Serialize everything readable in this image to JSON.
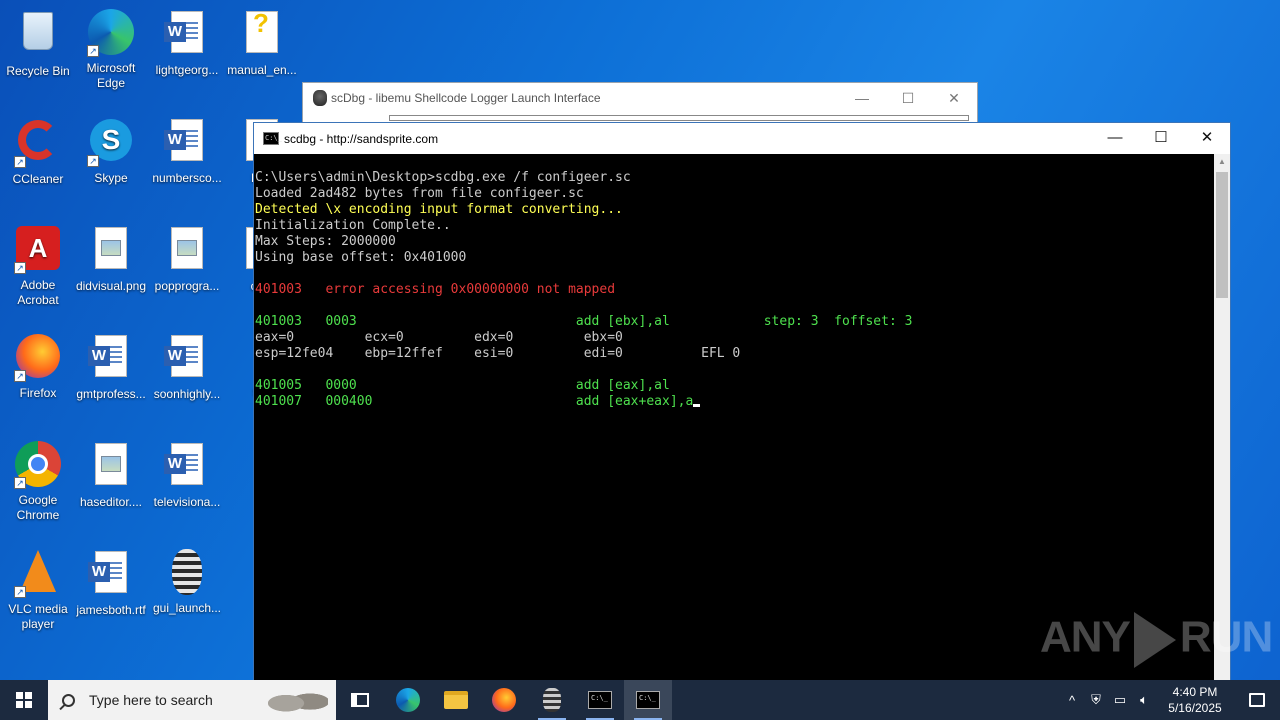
{
  "desktop": {
    "icons": [
      {
        "label": "Recycle Bin",
        "icon": "recycle-bin-icon"
      },
      {
        "label": "Microsoft Edge",
        "icon": "edge-icon"
      },
      {
        "label": "lightgeorg...",
        "icon": "word-doc-icon"
      },
      {
        "label": "manual_en...",
        "icon": "help-doc-icon"
      },
      {
        "label": "CCleaner",
        "icon": "ccleaner-icon"
      },
      {
        "label": "Skype",
        "icon": "skype-icon"
      },
      {
        "label": "numbersco...",
        "icon": "word-doc-icon"
      },
      {
        "label": "Rea",
        "icon": "doc-icon"
      },
      {
        "label": "Adobe Acrobat",
        "icon": "acrobat-icon"
      },
      {
        "label": "didvisual.png",
        "icon": "image-file-icon"
      },
      {
        "label": "popprogra...",
        "icon": "image-file-icon"
      },
      {
        "label": "conf",
        "icon": "doc-icon"
      },
      {
        "label": "Firefox",
        "icon": "firefox-icon"
      },
      {
        "label": "gmtprofess...",
        "icon": "word-doc-icon"
      },
      {
        "label": "soonhighly...",
        "icon": "word-doc-icon"
      },
      {
        "label": "scd",
        "icon": "doc-icon"
      },
      {
        "label": "Google Chrome",
        "icon": "chrome-icon"
      },
      {
        "label": "haseditor....",
        "icon": "image-file-icon"
      },
      {
        "label": "televisiona...",
        "icon": "word-doc-icon"
      },
      {
        "label": "VLC media player",
        "icon": "vlc-icon"
      },
      {
        "label": "jamesboth.rtf",
        "icon": "word-doc-icon"
      },
      {
        "label": "gui_launch...",
        "icon": "scdbg-bug-icon"
      }
    ]
  },
  "back_window": {
    "title": "scDbg - libemu Shellcode Logger Launch Interface",
    "controls": {
      "minimize": "—",
      "maximize": "☐",
      "close": "✕"
    }
  },
  "console": {
    "title": "scdbg - http://sandsprite.com",
    "controls": {
      "minimize": "—",
      "maximize": "☐",
      "close": "✕"
    },
    "lines": [
      {
        "text": "C:\\Users\\admin\\Desktop>scdbg.exe /f configeer.sc",
        "color": "gray"
      },
      {
        "text": "Loaded 2ad482 bytes from file configeer.sc",
        "color": "gray"
      },
      {
        "text": "Detected \\x encoding input format converting...",
        "color": "yellow"
      },
      {
        "text": "Initialization Complete..",
        "color": "gray"
      },
      {
        "text": "Max Steps: 2000000",
        "color": "gray"
      },
      {
        "text": "Using base offset: 0x401000",
        "color": "gray"
      },
      {
        "text": "",
        "color": "gray"
      },
      {
        "text": "401003   error accessing 0x00000000 not mapped",
        "color": "red"
      },
      {
        "text": "",
        "color": "gray"
      },
      {
        "text": "401003   0003                            add [ebx],al            step: 3  foffset: 3",
        "color": "green"
      },
      {
        "text": "eax=0         ecx=0         edx=0         ebx=0",
        "color": "gray"
      },
      {
        "text": "esp=12fe04    ebp=12ffef    esi=0         edi=0          EFL 0",
        "color": "gray"
      },
      {
        "text": "",
        "color": "gray"
      },
      {
        "text": "401005   0000                            add [eax],al",
        "color": "green"
      },
      {
        "text": "401007   000400                          add [eax+eax],a",
        "color": "green"
      }
    ]
  },
  "watermark": {
    "left": "ANY",
    "right": "RUN"
  },
  "taskbar": {
    "search_placeholder": "Type here to search",
    "apps": [
      {
        "name": "task-view",
        "icon": "task-view-icon"
      },
      {
        "name": "edge",
        "icon": "edge-icon"
      },
      {
        "name": "file-explorer",
        "icon": "folder-icon"
      },
      {
        "name": "firefox",
        "icon": "firefox-icon"
      },
      {
        "name": "scdbg-gui",
        "icon": "scdbg-bug-icon"
      },
      {
        "name": "cmd",
        "icon": "cmd-icon"
      },
      {
        "name": "scdbg-console",
        "icon": "cmd-icon"
      }
    ],
    "clock": {
      "time": "4:40 PM",
      "date": "5/16/2025"
    }
  }
}
